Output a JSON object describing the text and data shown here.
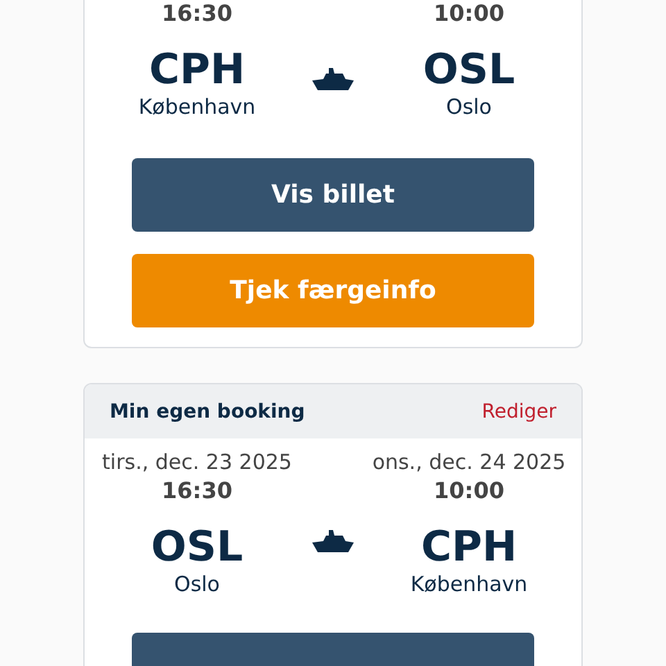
{
  "bookings": [
    {
      "departure": {
        "time": "16:30",
        "code": "CPH",
        "city": "København"
      },
      "arrival": {
        "time": "10:00",
        "code": "OSL",
        "city": "Oslo"
      },
      "buttons": [
        {
          "kind": "primary",
          "label": "Vis billet"
        },
        {
          "kind": "accent",
          "label": "Tjek færgeinfo"
        }
      ]
    },
    {
      "header": {
        "title": "Min egen booking",
        "action": "Rediger"
      },
      "departure": {
        "date": "tirs., dec. 23 2025",
        "time": "16:30",
        "code": "OSL",
        "city": "Oslo"
      },
      "arrival": {
        "date": "ons., dec. 24 2025",
        "time": "10:00",
        "code": "CPH",
        "city": "København"
      },
      "buttons": [
        {
          "kind": "primary"
        }
      ]
    }
  ]
}
